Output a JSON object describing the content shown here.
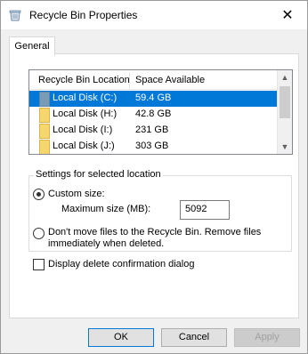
{
  "window": {
    "title": "Recycle Bin Properties",
    "close_glyph": "✕"
  },
  "tabs": [
    {
      "label": "General",
      "selected": true
    }
  ],
  "list": {
    "columns": [
      "Recycle Bin Location",
      "Space Available"
    ],
    "rows": [
      {
        "location": "Local Disk (C:)",
        "space": "59.4 GB",
        "selected": true
      },
      {
        "location": "Local Disk (H:)",
        "space": "42.8 GB",
        "selected": false
      },
      {
        "location": "Local Disk (I:)",
        "space": "231 GB",
        "selected": false
      },
      {
        "location": "Local Disk (J:)",
        "space": "303 GB",
        "selected": false
      }
    ],
    "scroll_up": "▲",
    "scroll_down": "▼"
  },
  "settings": {
    "group_title": "Settings for selected location",
    "custom_size_label": "Custom size:",
    "custom_size_selected": true,
    "max_size_label": "Maximum size (MB):",
    "max_size_value": "5092",
    "dont_move_label": "Don't move files to the Recycle Bin. Remove files immediately when deleted.",
    "dont_move_selected": false
  },
  "confirm": {
    "label": "Display delete confirmation dialog",
    "checked": false
  },
  "buttons": {
    "ok": "OK",
    "cancel": "Cancel",
    "apply": "Apply",
    "apply_enabled": false
  },
  "colors": {
    "selection": "#0078d7",
    "folder": "#f5d76e",
    "disabled_text": "#a0a0a0"
  },
  "icons": {
    "title": "recycle-bin-icon",
    "row": "folder-icon"
  }
}
